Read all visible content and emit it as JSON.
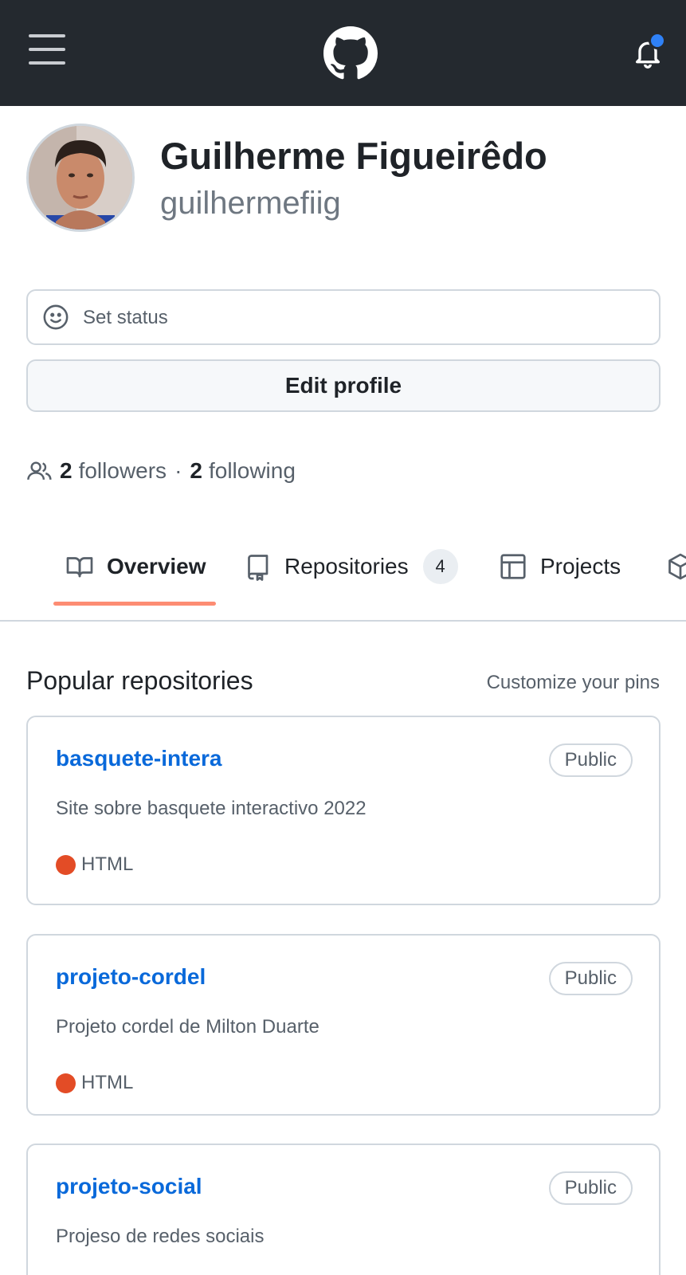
{
  "header": {
    "menu_icon": "hamburger-menu-icon",
    "logo_icon": "github-logo-icon",
    "notifications_icon": "bell-icon",
    "notification_dot_color": "#2f81f7"
  },
  "profile": {
    "full_name": "Guilherme Figueirêdo",
    "username": "guilhermefiig"
  },
  "status": {
    "icon": "smiley-icon",
    "label": "Set status"
  },
  "edit_profile_label": "Edit profile",
  "follow": {
    "followers_count": "2",
    "followers_label": "followers",
    "separator": "·",
    "following_count": "2",
    "following_label": "following"
  },
  "tabs": [
    {
      "label": "Overview",
      "icon": "book-icon",
      "active": true
    },
    {
      "label": "Repositories",
      "icon": "repo-icon",
      "counter": "4"
    },
    {
      "label": "Projects",
      "icon": "table-icon"
    },
    {
      "label": "",
      "icon": "package-icon"
    }
  ],
  "popular": {
    "title": "Popular repositories",
    "customize_label": "Customize your pins",
    "repos": [
      {
        "name": "basquete-intera",
        "visibility": "Public",
        "description": "Site sobre basquete interactivo 2022",
        "language": "HTML",
        "language_color": "#e34c26"
      },
      {
        "name": "projeto-cordel",
        "visibility": "Public",
        "description": "Projeto cordel de Milton Duarte",
        "language": "HTML",
        "language_color": "#e34c26"
      },
      {
        "name": "projeto-social",
        "visibility": "Public",
        "description": "Projeso de redes sociais"
      }
    ]
  },
  "colors": {
    "header_bg": "#24292f",
    "link": "#0969da",
    "tab_underline": "#fd8c73"
  }
}
